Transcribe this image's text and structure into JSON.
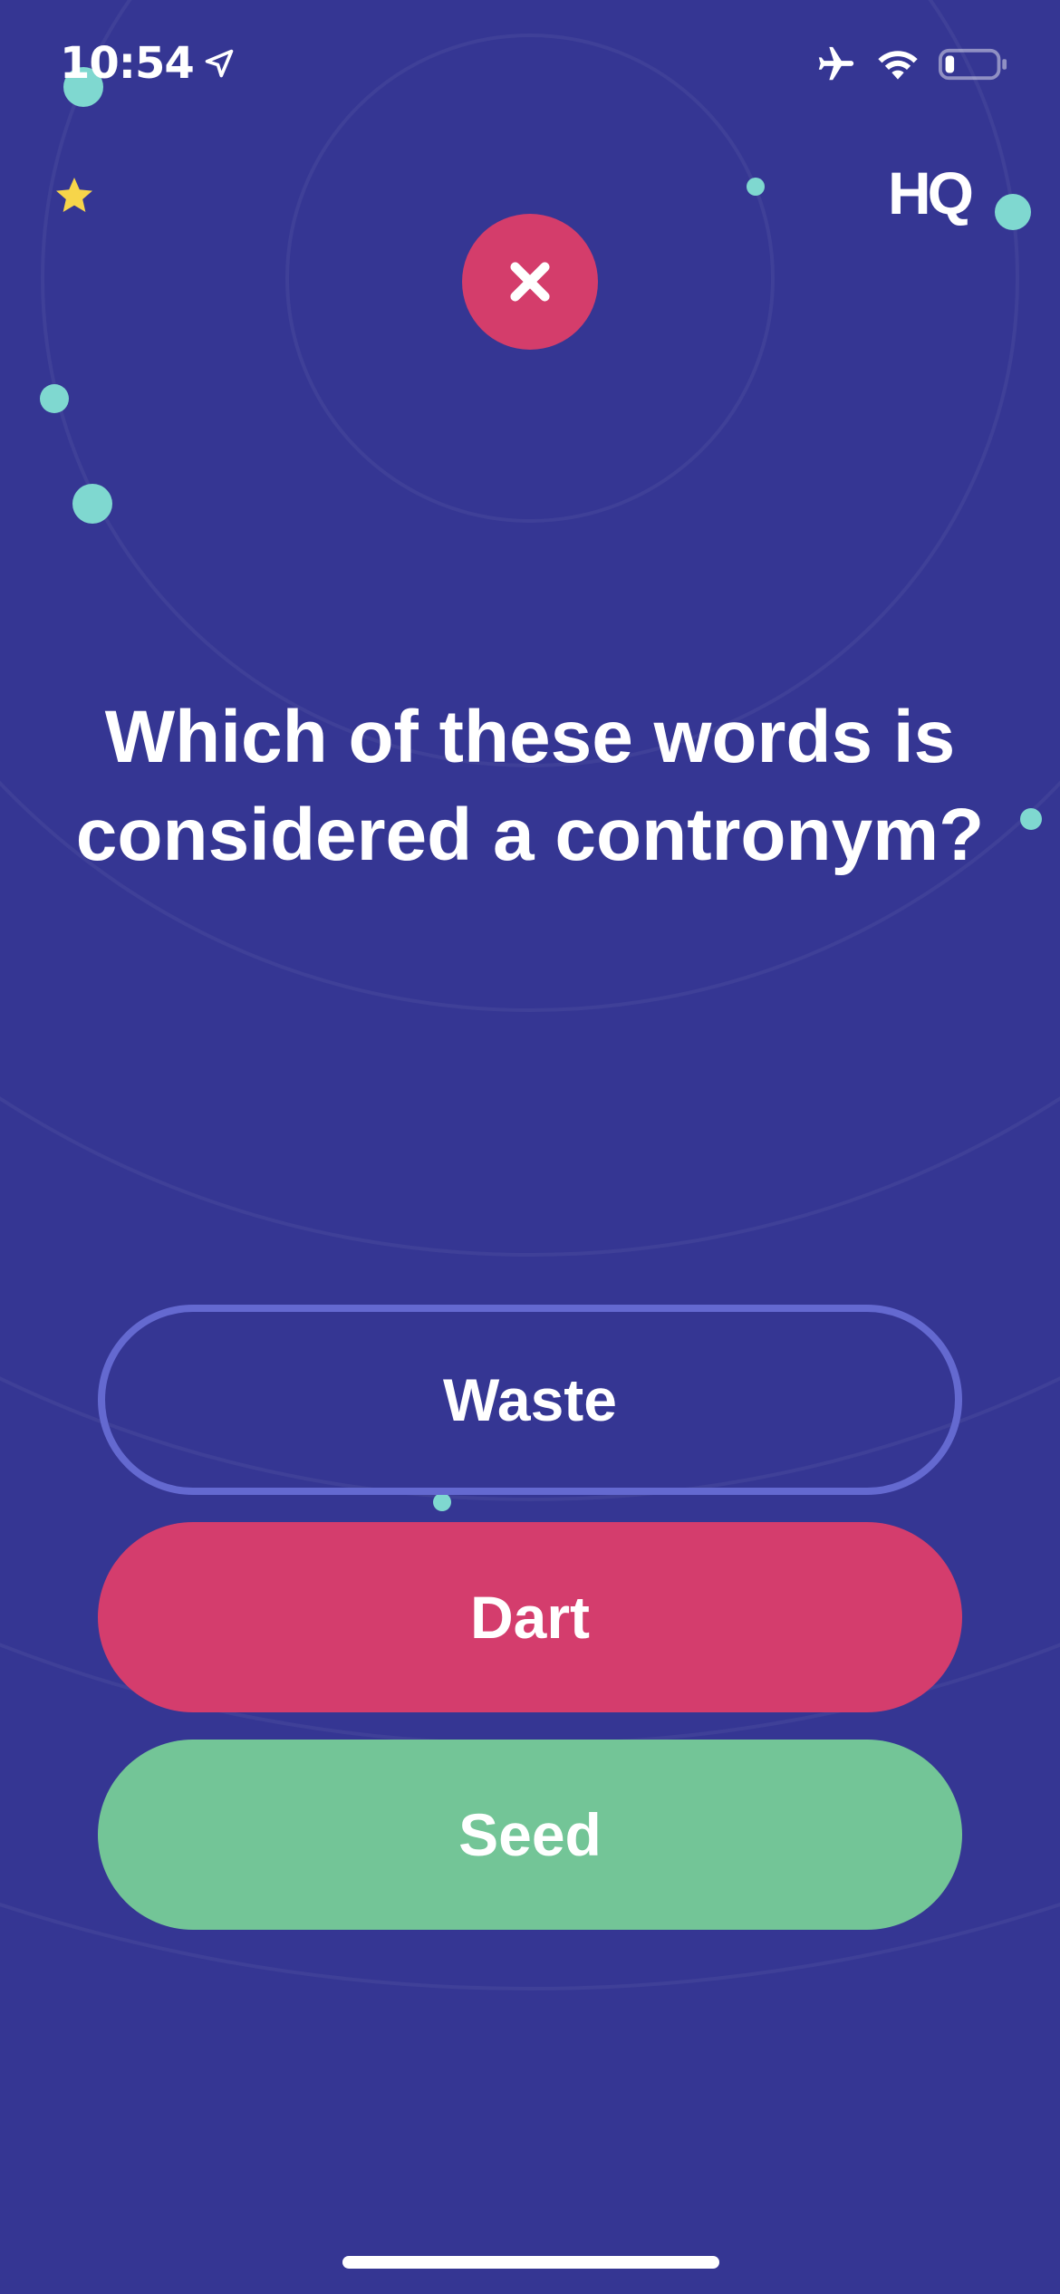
{
  "status_bar": {
    "time": "10:54",
    "icons": [
      "location-arrow-icon",
      "airplane-icon",
      "wifi-icon",
      "battery-icon"
    ]
  },
  "header": {
    "star_icon": "star-icon",
    "logo_text": "HQ"
  },
  "result": {
    "icon": "close-x-icon",
    "color": "#d43d6b"
  },
  "question": {
    "text": "Which of these words is considered a contronym?"
  },
  "answers": [
    {
      "label": "Waste",
      "state": "neutral"
    },
    {
      "label": "Dart",
      "state": "wrong",
      "color": "#d43d6d"
    },
    {
      "label": "Seed",
      "state": "correct",
      "color": "#73c597"
    }
  ],
  "colors": {
    "background": "#353693",
    "accent_teal": "#7fd8d0",
    "star": "#f7d54a",
    "neutral_border": "#6469d0"
  }
}
